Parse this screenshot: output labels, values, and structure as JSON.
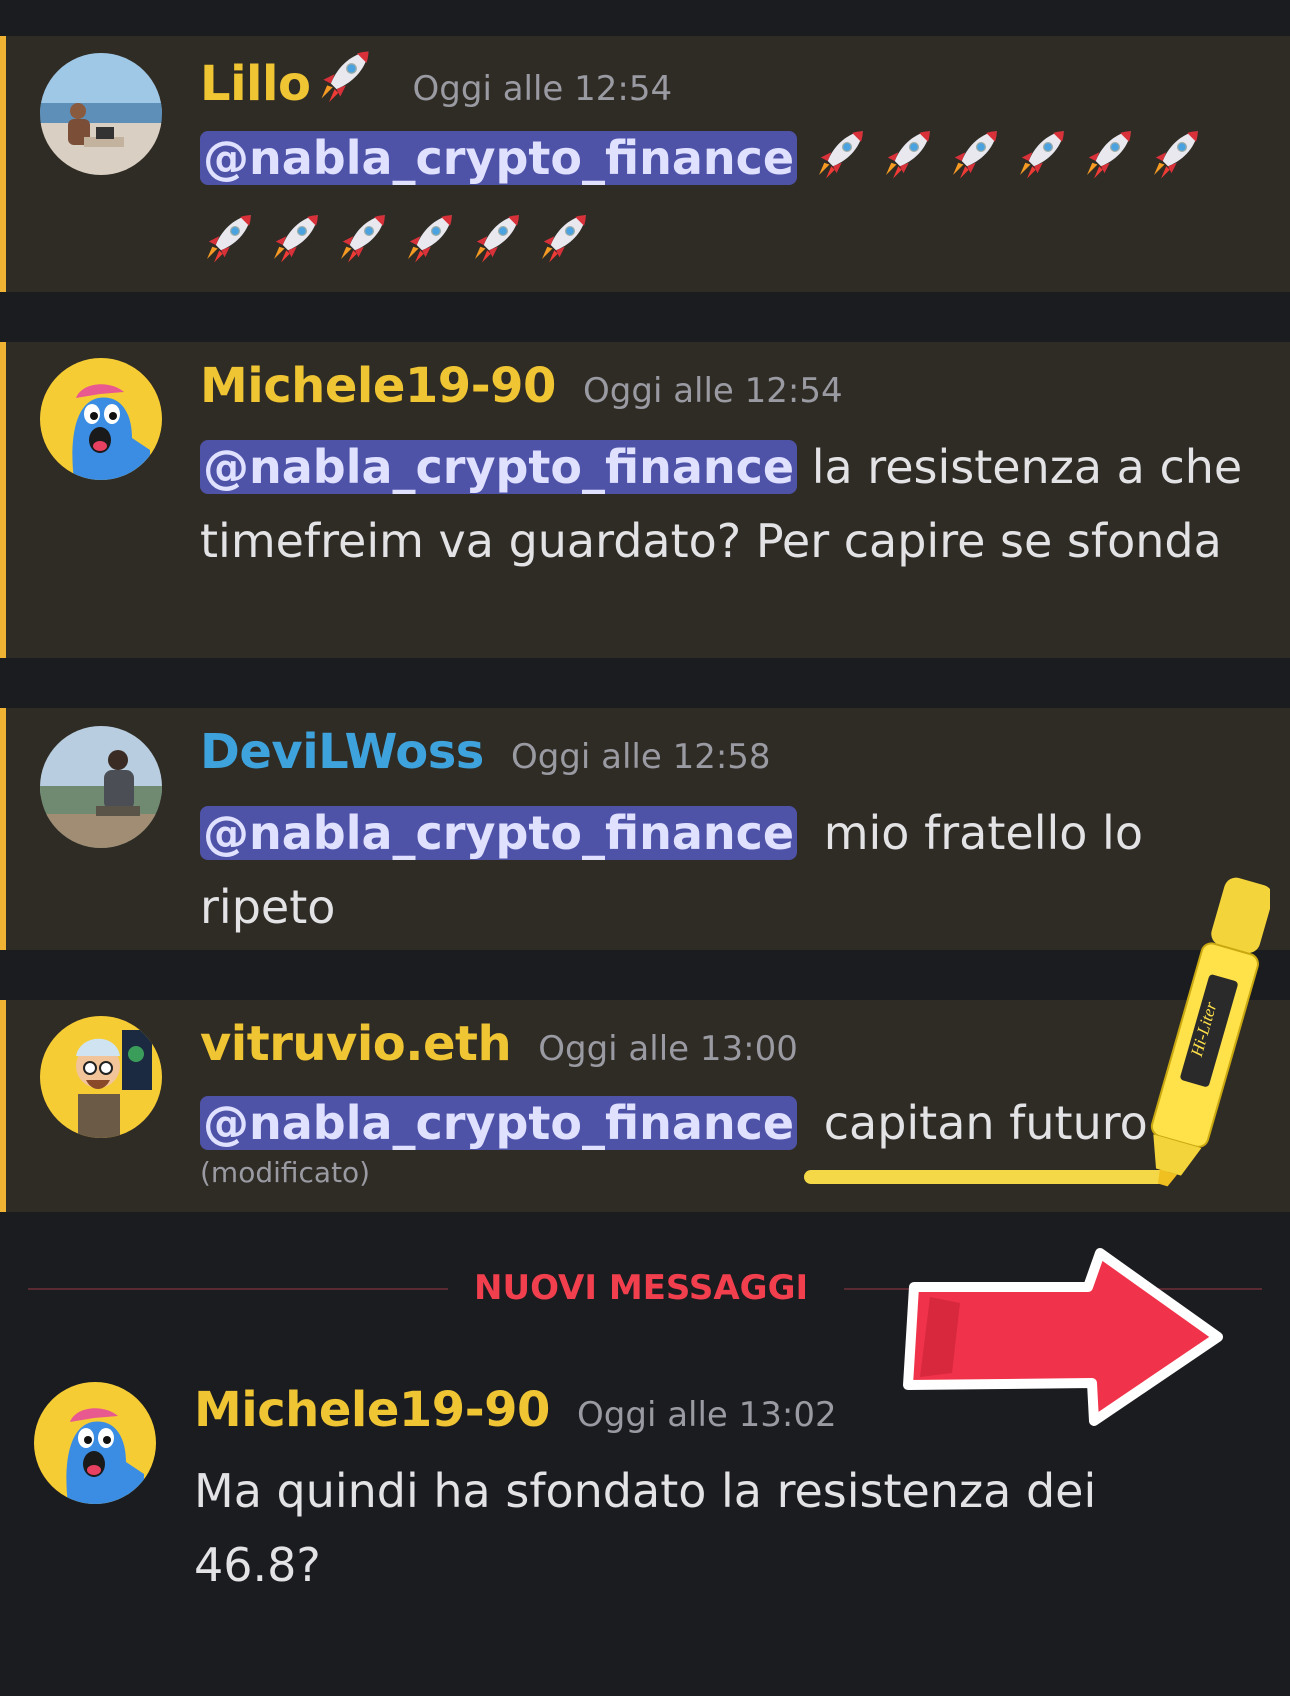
{
  "messages": [
    {
      "username": "Lillo",
      "username_color": "#f0c533",
      "timestamp": "Oggi alle 12:54",
      "mention": "@nabla_crypto_finance",
      "text": "",
      "name_emoji": "rocket-emoji",
      "emoji_count": 12
    },
    {
      "username": "Michele19-90",
      "username_color": "#f0c533",
      "timestamp": "Oggi alle 12:54",
      "mention": "@nabla_crypto_finance",
      "text": "la resistenza a che timefreim va guardato? Per capire se sfonda"
    },
    {
      "username": "DeviLWoss",
      "username_color": "#3ea3dc",
      "timestamp": "Oggi alle 12:58",
      "mention": "@nabla_crypto_finance",
      "text": "mio fratello lo ripeto"
    },
    {
      "username": "vitruvio.eth",
      "username_color": "#f0c533",
      "timestamp": "Oggi alle 13:00",
      "mention": "@nabla_crypto_finance",
      "text": "capitan futuro",
      "edited": "(modificato)"
    }
  ],
  "divider": {
    "label": "NUOVI MESSAGGI",
    "color": "#f23f4e"
  },
  "new_message": {
    "username": "Michele19-90",
    "username_color": "#f0c533",
    "timestamp": "Oggi alle 13:02",
    "text": "Ma quindi ha sfondato la resistenza dei 46.8?"
  },
  "overlays": {
    "highlighter_brand": "Hi-Liter",
    "arrow_color": "#f0334a",
    "highlighter_color": "#ffe14a"
  }
}
